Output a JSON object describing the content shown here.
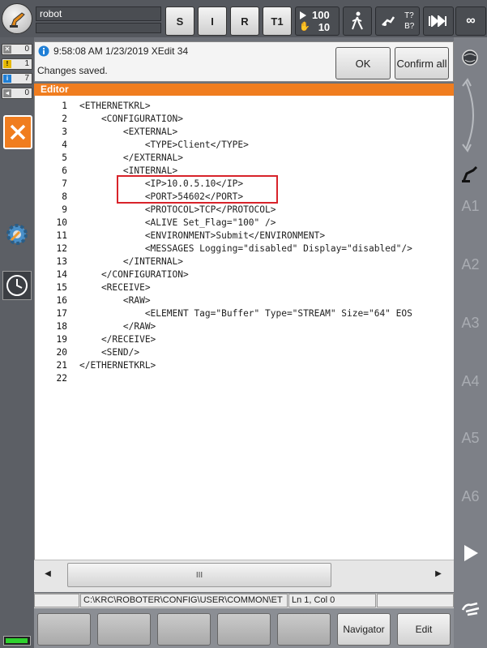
{
  "topbar": {
    "robot_name": "robot",
    "btn_s": "S",
    "btn_i": "I",
    "btn_r": "R",
    "btn_t1": "T1",
    "override_prog": "100",
    "override_jog": "10",
    "tool_t": "T?",
    "tool_b": "B?",
    "infinity": "∞"
  },
  "messages": {
    "counters": [
      "0",
      "1",
      "7",
      "0"
    ],
    "time_info": "9:58:08 AM 1/23/2019 XEdit 34",
    "text": "Changes saved.",
    "ok_label": "OK",
    "confirm_all_label": "Confirm all"
  },
  "editor": {
    "title": "Editor",
    "lines": [
      {
        "n": "1",
        "t": "<ETHERNETKRL>"
      },
      {
        "n": "2",
        "t": "    <CONFIGURATION>"
      },
      {
        "n": "3",
        "t": "        <EXTERNAL>"
      },
      {
        "n": "4",
        "t": "            <TYPE>Client</TYPE>"
      },
      {
        "n": "5",
        "t": "        </EXTERNAL>"
      },
      {
        "n": "6",
        "t": "        <INTERNAL>"
      },
      {
        "n": "7",
        "t": "            <IP>10.0.5.10</IP>"
      },
      {
        "n": "8",
        "t": "            <PORT>54602</PORT>"
      },
      {
        "n": "9",
        "t": "            <PROTOCOL>TCP</PROTOCOL>"
      },
      {
        "n": "10",
        "t": "            <ALIVE Set_Flag=\"100\" />"
      },
      {
        "n": "11",
        "t": "            <ENVIRONMENT>Submit</ENVIRONMENT>"
      },
      {
        "n": "12",
        "t": "            <MESSAGES Logging=\"disabled\" Display=\"disabled\"/>"
      },
      {
        "n": "13",
        "t": "        </INTERNAL>"
      },
      {
        "n": "14",
        "t": "    </CONFIGURATION>"
      },
      {
        "n": "15",
        "t": "    <RECEIVE>"
      },
      {
        "n": "16",
        "t": "        <RAW>"
      },
      {
        "n": "17",
        "t": "            <ELEMENT Tag=\"Buffer\" Type=\"STREAM\" Size=\"64\" EOS"
      },
      {
        "n": "18",
        "t": "        </RAW>"
      },
      {
        "n": "19",
        "t": "    </RECEIVE>"
      },
      {
        "n": "20",
        "t": "    <SEND/>"
      },
      {
        "n": "21",
        "t": "</ETHERNETKRL>"
      },
      {
        "n": "22",
        "t": ""
      }
    ]
  },
  "scrollbar": {
    "thumb_grip": "III"
  },
  "statusbar": {
    "path": "C:\\KRC\\ROBOTER\\CONFIG\\USER\\COMMON\\ET",
    "position": "Ln 1, Col 0"
  },
  "right_axes": [
    "A1",
    "A2",
    "A3",
    "A4",
    "A5",
    "A6"
  ],
  "softkeys": {
    "navigator": "Navigator",
    "edit": "Edit"
  },
  "colors": {
    "accent_orange": "#f07d1f",
    "highlight_red": "#d8232a"
  }
}
